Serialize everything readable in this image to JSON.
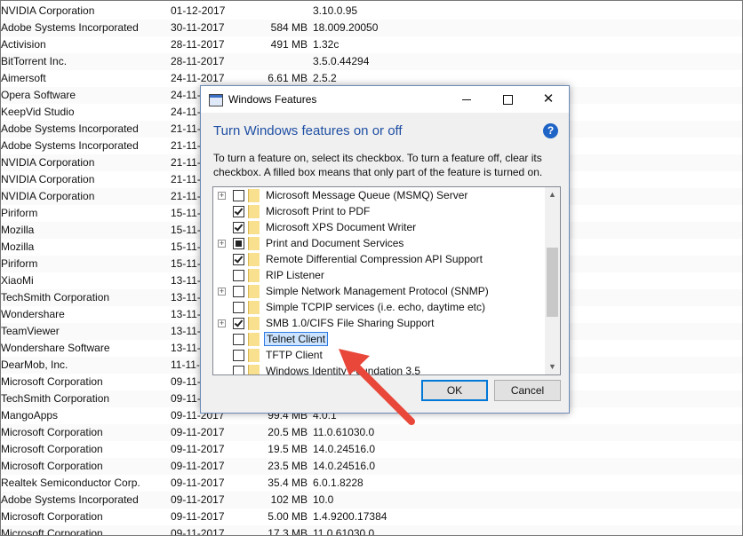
{
  "background_list": [
    {
      "publisher": "NVIDIA Corporation",
      "date": "01-12-2017",
      "size": "",
      "version": "3.10.0.95"
    },
    {
      "publisher": "Adobe Systems Incorporated",
      "date": "30-11-2017",
      "size": "584 MB",
      "version": "18.009.20050"
    },
    {
      "publisher": "Activision",
      "date": "28-11-2017",
      "size": "491 MB",
      "version": "1.32c"
    },
    {
      "publisher": "BitTorrent Inc.",
      "date": "28-11-2017",
      "size": "",
      "version": "3.5.0.44294"
    },
    {
      "publisher": "Aimersoft",
      "date": "24-11-2017",
      "size": "6.61 MB",
      "version": "2.5.2"
    },
    {
      "publisher": "Opera Software",
      "date": "24-11-",
      "size": "",
      "version": ""
    },
    {
      "publisher": "KeepVid Studio",
      "date": "24-11-",
      "size": "",
      "version": ""
    },
    {
      "publisher": "Adobe Systems Incorporated",
      "date": "21-11-",
      "size": "",
      "version": ""
    },
    {
      "publisher": "Adobe Systems Incorporated",
      "date": "21-11-",
      "size": "",
      "version": ""
    },
    {
      "publisher": "NVIDIA Corporation",
      "date": "21-11-",
      "size": "",
      "version": ""
    },
    {
      "publisher": "NVIDIA Corporation",
      "date": "21-11-",
      "size": "",
      "version": ""
    },
    {
      "publisher": "NVIDIA Corporation",
      "date": "21-11-",
      "size": "",
      "version": ""
    },
    {
      "publisher": "Piriform",
      "date": "15-11-",
      "size": "",
      "version": ""
    },
    {
      "publisher": "Mozilla",
      "date": "15-11-",
      "size": "",
      "version": ""
    },
    {
      "publisher": "Mozilla",
      "date": "15-11-",
      "size": "",
      "version": ""
    },
    {
      "publisher": "Piriform",
      "date": "15-11-",
      "size": "",
      "version": ""
    },
    {
      "publisher": "XiaoMi",
      "date": "13-11-",
      "size": "",
      "version": ""
    },
    {
      "publisher": "TechSmith Corporation",
      "date": "13-11-",
      "size": "",
      "version": ""
    },
    {
      "publisher": "Wondershare",
      "date": "13-11-",
      "size": "",
      "version": ""
    },
    {
      "publisher": "TeamViewer",
      "date": "13-11-",
      "size": "",
      "version": ""
    },
    {
      "publisher": "Wondershare Software",
      "date": "13-11-",
      "size": "",
      "version": ""
    },
    {
      "publisher": "DearMob, Inc.",
      "date": "11-11-",
      "size": "",
      "version": ""
    },
    {
      "publisher": "Microsoft Corporation",
      "date": "09-11-",
      "size": "",
      "version": ""
    },
    {
      "publisher": "TechSmith Corporation",
      "date": "09-11-",
      "size": "",
      "version": ""
    },
    {
      "publisher": "MangoApps",
      "date": "09-11-2017",
      "size": "99.4 MB",
      "version": "4.0.1"
    },
    {
      "publisher": "Microsoft Corporation",
      "date": "09-11-2017",
      "size": "20.5 MB",
      "version": "11.0.61030.0"
    },
    {
      "publisher": "Microsoft Corporation",
      "date": "09-11-2017",
      "size": "19.5 MB",
      "version": "14.0.24516.0"
    },
    {
      "publisher": "Microsoft Corporation",
      "date": "09-11-2017",
      "size": "23.5 MB",
      "version": "14.0.24516.0"
    },
    {
      "publisher": "Realtek Semiconductor Corp.",
      "date": "09-11-2017",
      "size": "35.4 MB",
      "version": "6.0.1.8228"
    },
    {
      "publisher": "Adobe Systems Incorporated",
      "date": "09-11-2017",
      "size": "102 MB",
      "version": "10.0"
    },
    {
      "publisher": "Microsoft Corporation",
      "date": "09-11-2017",
      "size": "5.00 MB",
      "version": "1.4.9200.17384"
    },
    {
      "publisher": "Microsoft Corporation",
      "date": "09-11-2017",
      "size": "17.3 MB",
      "version": "11.0.61030.0"
    }
  ],
  "dialog": {
    "title": "Windows Features",
    "heading": "Turn Windows features on or off",
    "help_glyph": "?",
    "description": "To turn a feature on, select its checkbox. To turn a feature off, clear its checkbox. A filled box means that only part of the feature is turned on.",
    "features": [
      {
        "label": "Microsoft Message Queue (MSMQ) Server",
        "expandable": true,
        "state": "unchecked",
        "selected": false
      },
      {
        "label": "Microsoft Print to PDF",
        "expandable": false,
        "state": "checked",
        "selected": false
      },
      {
        "label": "Microsoft XPS Document Writer",
        "expandable": false,
        "state": "checked",
        "selected": false
      },
      {
        "label": "Print and Document Services",
        "expandable": true,
        "state": "partial",
        "selected": false
      },
      {
        "label": "Remote Differential Compression API Support",
        "expandable": false,
        "state": "checked",
        "selected": false
      },
      {
        "label": "RIP Listener",
        "expandable": false,
        "state": "unchecked",
        "selected": false
      },
      {
        "label": "Simple Network Management Protocol (SNMP)",
        "expandable": true,
        "state": "unchecked",
        "selected": false
      },
      {
        "label": "Simple TCPIP services (i.e. echo, daytime etc)",
        "expandable": false,
        "state": "unchecked",
        "selected": false
      },
      {
        "label": "SMB 1.0/CIFS File Sharing Support",
        "expandable": true,
        "state": "checked",
        "selected": false
      },
      {
        "label": "Telnet Client",
        "expandable": false,
        "state": "unchecked",
        "selected": true
      },
      {
        "label": "TFTP Client",
        "expandable": false,
        "state": "unchecked",
        "selected": false
      },
      {
        "label": "Windows Identity Foundation 3.5",
        "expandable": false,
        "state": "unchecked",
        "selected": false
      }
    ],
    "ok_label": "OK",
    "cancel_label": "Cancel"
  },
  "colors": {
    "heading": "#1f4fa3",
    "selection_bg": "#cce4ff",
    "arrow": "#e8473a"
  }
}
